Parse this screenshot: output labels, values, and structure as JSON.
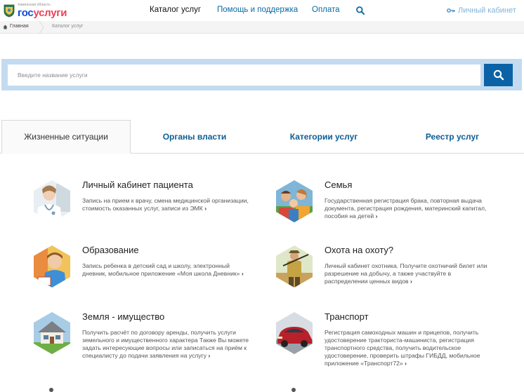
{
  "header": {
    "logo_region": "тюменская область",
    "logo_gos": "гос",
    "logo_uslugi": "услуги",
    "nav": {
      "catalog": "Каталог услуг",
      "help": "Помощь и поддержка",
      "pay": "Оплата"
    },
    "cabinet": "Личный кабинет"
  },
  "breadcrumb": {
    "home": "Главная",
    "current": "Каталог услуг"
  },
  "search": {
    "placeholder": "Введите название услуги"
  },
  "tabs": [
    {
      "label": "Жизненные ситуации"
    },
    {
      "label": "Органы власти"
    },
    {
      "label": "Категории услуг"
    },
    {
      "label": "Реестр услуг"
    }
  ],
  "cards": [
    {
      "title": "Личный кабинет пациента",
      "desc": "Запись на прием к врачу, смена медицинской организации, стоимость оказанных услуг, записи из ЭМК",
      "image": "doctor-photo"
    },
    {
      "title": "Семья",
      "desc": "Государственная регистрация брака, повторная выдача документа, регистрация рождения, материнский капитал, пособия на детей",
      "image": "family-photo"
    },
    {
      "title": "Образование",
      "desc": "Запись ребенка в детский сад и школу, электронный дневник, мобильное приложение «Моя школа Дневник»",
      "image": "schoolboy-photo"
    },
    {
      "title": "Охота на охоту?",
      "desc": "Личный кабинет охотника. Получите охотничий билет или разрешение на добычу, а также участвуйте в распределении ценных видов",
      "image": "hunter-photo"
    },
    {
      "title": "Земля - имущество",
      "desc": "Получить расчёт по договору аренды, получить услуги земельного и имущественного характера Также Вы можете задать интересующие вопросы или записаться на приём к специалисту до подачи заявления на услугу",
      "image": "house-photo"
    },
    {
      "title": "Транспорт",
      "desc": "Регистрация самоходных машин и прицепов, получить удостоверение тракториста-машиниста, регистрация транспортного средства, получить водительское удостоверение, проверить штрафы ГИБДД, мобильное приложение «Транспорт72»",
      "image": "car-photo"
    }
  ],
  "colors": {
    "accent": "#0b63a6",
    "link": "#0b6aa2",
    "search_bg": "#c3dbf0",
    "logo_blue": "#0d4cd3",
    "logo_red": "#ee3f58"
  }
}
